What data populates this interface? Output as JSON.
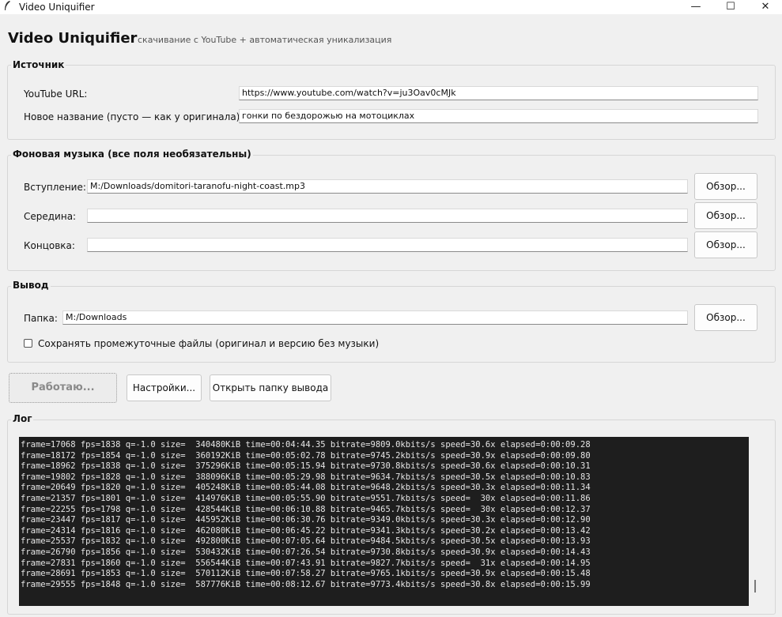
{
  "window": {
    "title": "Video Uniquifier",
    "minimize_glyph": "—",
    "maximize_glyph": "☐",
    "close_glyph": "✕"
  },
  "header": {
    "title": "Video Uniquifier",
    "subtitle": "скачивание с YouTube + автоматическая уникализация"
  },
  "source": {
    "title": "Источник",
    "url_label": "YouTube URL:",
    "url_value": "https://www.youtube.com/watch?v=ju3Oav0cMJk",
    "name_label": "Новое название (пусто — как у оригинала):",
    "name_value": "гонки по бездорожью на мотоциклах"
  },
  "music": {
    "title": "Фоновая музыка (все поля необязательны)",
    "intro_label": "Вступление:",
    "intro_value": "M:/Downloads/domitori-taranofu-night-coast.mp3",
    "middle_label": "Середина:",
    "middle_value": "",
    "outro_label": "Концовка:",
    "outro_value": "",
    "browse_label": "Обзор..."
  },
  "output": {
    "title": "Вывод",
    "folder_label": "Папка:",
    "folder_value": "M:/Downloads",
    "browse_label": "Обзор...",
    "keep_files_label": "Сохранять промежуточные файлы (оригинал и версию без музыки)",
    "keep_files_checked": false
  },
  "actions": {
    "run_label": "Работаю...",
    "settings_label": "Настройки...",
    "open_folder_label": "Открыть папку вывода"
  },
  "log": {
    "title": "Лог",
    "lines": [
      "frame=17068 fps=1838 q=-1.0 size=  340480KiB time=00:04:44.35 bitrate=9809.0kbits/s speed=30.6x elapsed=0:00:09.28",
      "frame=18172 fps=1854 q=-1.0 size=  360192KiB time=00:05:02.78 bitrate=9745.2kbits/s speed=30.9x elapsed=0:00:09.80",
      "frame=18962 fps=1838 q=-1.0 size=  375296KiB time=00:05:15.94 bitrate=9730.8kbits/s speed=30.6x elapsed=0:00:10.31",
      "frame=19802 fps=1828 q=-1.0 size=  388096KiB time=00:05:29.98 bitrate=9634.7kbits/s speed=30.5x elapsed=0:00:10.83",
      "frame=20649 fps=1820 q=-1.0 size=  405248KiB time=00:05:44.08 bitrate=9648.2kbits/s speed=30.3x elapsed=0:00:11.34",
      "frame=21357 fps=1801 q=-1.0 size=  414976KiB time=00:05:55.90 bitrate=9551.7kbits/s speed=  30x elapsed=0:00:11.86",
      "frame=22255 fps=1798 q=-1.0 size=  428544KiB time=00:06:10.88 bitrate=9465.7kbits/s speed=  30x elapsed=0:00:12.37",
      "frame=23447 fps=1817 q=-1.0 size=  445952KiB time=00:06:30.76 bitrate=9349.0kbits/s speed=30.3x elapsed=0:00:12.90",
      "frame=24314 fps=1816 q=-1.0 size=  462080KiB time=00:06:45.22 bitrate=9341.3kbits/s speed=30.2x elapsed=0:00:13.42",
      "frame=25537 fps=1832 q=-1.0 size=  492800KiB time=00:07:05.64 bitrate=9484.5kbits/s speed=30.5x elapsed=0:00:13.93",
      "frame=26790 fps=1856 q=-1.0 size=  530432KiB time=00:07:26.54 bitrate=9730.8kbits/s speed=30.9x elapsed=0:00:14.43",
      "frame=27831 fps=1860 q=-1.0 size=  556544KiB time=00:07:43.91 bitrate=9827.7kbits/s speed=  31x elapsed=0:00:14.95",
      "frame=28691 fps=1853 q=-1.0 size=  570112KiB time=00:07:58.27 bitrate=9765.1kbits/s speed=30.9x elapsed=0:00:15.48",
      "frame=29555 fps=1848 q=-1.0 size=  587776KiB time=00:08:12.67 bitrate=9773.4kbits/s speed=30.8x elapsed=0:00:15.99"
    ]
  }
}
